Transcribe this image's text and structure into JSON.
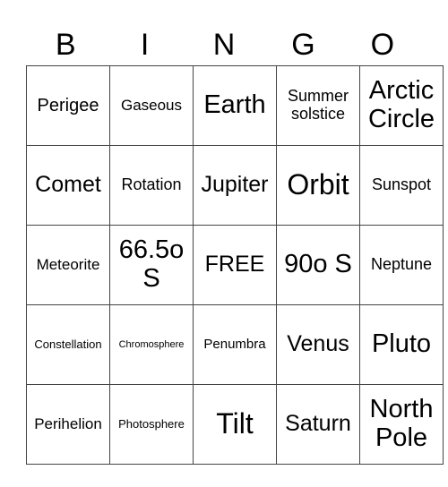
{
  "header": [
    "B",
    "I",
    "N",
    "G",
    "O"
  ],
  "grid": [
    [
      "Perigee",
      "Gaseous",
      "Earth",
      "Summer solstice",
      "Arctic Circle"
    ],
    [
      "Comet",
      "Rotation",
      "Jupiter",
      "Orbit",
      "Sunspot"
    ],
    [
      "Meteorite",
      "66.5o S",
      "FREE",
      "90o S",
      "Neptune"
    ],
    [
      "Constellation",
      "Chromosphere",
      "Penumbra",
      "Venus",
      "Pluto"
    ],
    [
      "Perihelion",
      "Photosphere",
      "Tilt",
      "Saturn",
      "North Pole"
    ]
  ]
}
